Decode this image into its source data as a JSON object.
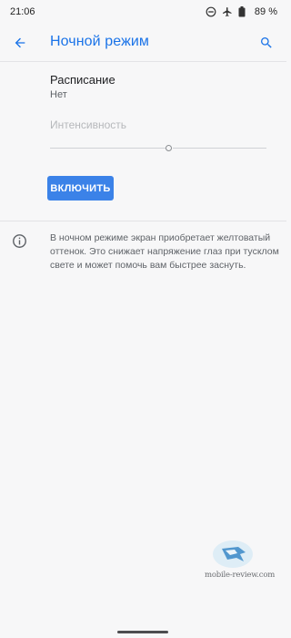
{
  "status_bar": {
    "time": "21:06",
    "icons": [
      "dnd-icon",
      "airplane-icon",
      "battery-icon"
    ],
    "battery": "89 %"
  },
  "app_bar": {
    "title": "Ночной режим",
    "back_icon": "arrow-back-icon",
    "search_icon": "search-icon"
  },
  "schedule": {
    "title": "Расписание",
    "value": "Нет"
  },
  "intensity": {
    "label": "Интенсивность",
    "level": 0.55
  },
  "enable_button": {
    "label": "ВКЛЮЧИТЬ"
  },
  "info": {
    "icon": "info-icon",
    "text": "В ночном режиме экран приобретает желтоватый оттенок. Это снижает напряжение глаз при тусклом свете и может помочь вам быстрее заснуть."
  },
  "watermark": {
    "text": "mobile-review.com"
  },
  "colors": {
    "accent": "#1a73e8",
    "button": "#3b82e8",
    "background": "#f7f7f8"
  }
}
